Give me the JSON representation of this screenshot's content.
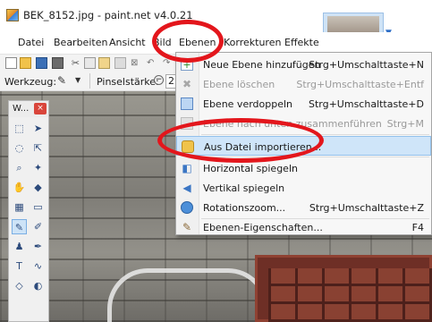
{
  "window": {
    "title": "BEK_8152.jpg - paint.net v4.0.21"
  },
  "menubar": {
    "items": [
      {
        "label": "Datei"
      },
      {
        "label": "Bearbeiten"
      },
      {
        "label": "Ansicht"
      },
      {
        "label": "Bild"
      },
      {
        "label": "Ebenen"
      },
      {
        "label": "Korrekturen"
      },
      {
        "label": "Effekte"
      }
    ],
    "active": "Ebenen"
  },
  "toolbar": {
    "tool_label": "Werkzeug:",
    "brush_width_label": "Pinselstärke:",
    "brush_width_value": "2"
  },
  "tools_panel": {
    "title": "W...",
    "close_label": "×"
  },
  "layer_menu": {
    "items": [
      {
        "label": "Neue Ebene hinzufügen",
        "shortcut": "Strg+Umschalttaste+N",
        "enabled": true,
        "icon": "new-layer-icon"
      },
      {
        "label": "Ebene löschen",
        "shortcut": "Strg+Umschalttaste+Entf",
        "enabled": false,
        "icon": "delete-layer-icon"
      },
      {
        "label": "Ebene verdoppeln",
        "shortcut": "Strg+Umschalttaste+D",
        "enabled": true,
        "icon": "duplicate-layer-icon"
      },
      {
        "label": "Ebene nach unten zusammenführen",
        "shortcut": "Strg+M",
        "enabled": false,
        "icon": "merge-down-icon"
      },
      {
        "label": "Aus Datei importieren...",
        "shortcut": "",
        "enabled": true,
        "icon": "import-from-file-icon",
        "highlighted": true
      },
      {
        "label": "Horizontal spiegeln",
        "shortcut": "",
        "enabled": true,
        "icon": "flip-horizontal-icon"
      },
      {
        "label": "Vertikal spiegeln",
        "shortcut": "",
        "enabled": true,
        "icon": "flip-vertical-icon"
      },
      {
        "label": "Rotationszoom...",
        "shortcut": "Strg+Umschalttaste+Z",
        "enabled": true,
        "icon": "rotate-zoom-icon"
      },
      {
        "label": "Ebenen-Eigenschaften...",
        "shortcut": "F4",
        "enabled": true,
        "icon": "layer-properties-icon"
      }
    ]
  },
  "colors": {
    "accent_red": "#e3161c",
    "highlight": "#cfe5f9",
    "menu_bg": "#f7f7f7"
  }
}
